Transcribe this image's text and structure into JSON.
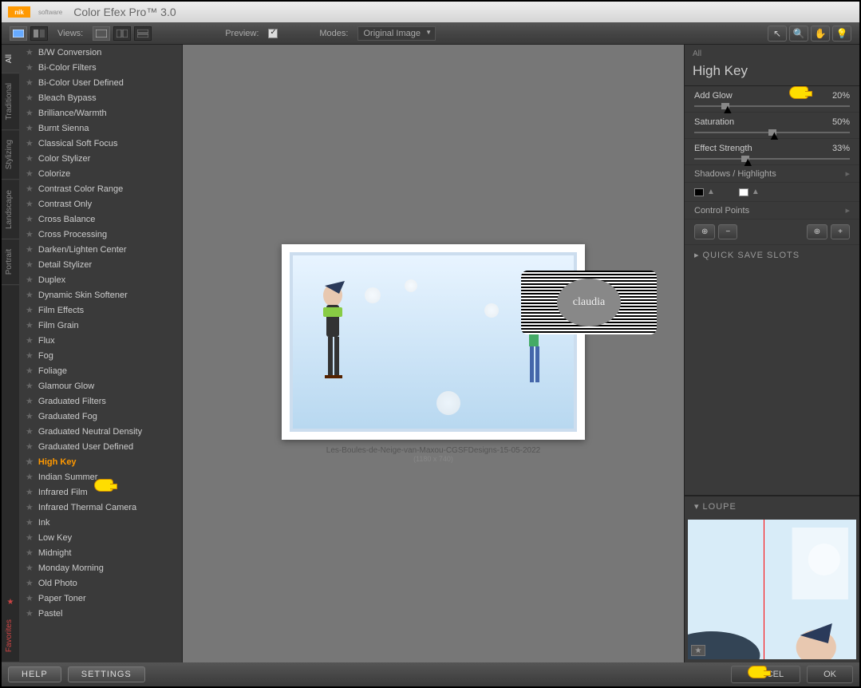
{
  "app": {
    "title": "Color Efex Pro™ 3.0",
    "brand": "nik",
    "brand_sub": "software"
  },
  "toolbar": {
    "views_label": "Views:",
    "preview_label": "Preview:",
    "modes_label": "Modes:",
    "mode_select": "Original Image"
  },
  "side_tabs": [
    "All",
    "Traditional",
    "Stylizing",
    "Landscape",
    "Portrait",
    "Favorites"
  ],
  "filters": [
    "B/W Conversion",
    "Bi-Color Filters",
    "Bi-Color User Defined",
    "Bleach Bypass",
    "Brilliance/Warmth",
    "Burnt Sienna",
    "Classical Soft Focus",
    "Color Stylizer",
    "Colorize",
    "Contrast Color Range",
    "Contrast Only",
    "Cross Balance",
    "Cross Processing",
    "Darken/Lighten Center",
    "Detail Stylizer",
    "Duplex",
    "Dynamic Skin Softener",
    "Film Effects",
    "Film Grain",
    "Flux",
    "Fog",
    "Foliage",
    "Glamour Glow",
    "Graduated Filters",
    "Graduated Fog",
    "Graduated Neutral Density",
    "Graduated User Defined",
    "High Key",
    "Indian Summer",
    "Infrared Film",
    "Infrared Thermal Camera",
    "Ink",
    "Low Key",
    "Midnight",
    "Monday Morning",
    "Old Photo",
    "Paper Toner",
    "Pastel"
  ],
  "selected_filter": "High Key",
  "preview": {
    "caption": "Les-Boules-de-Neige-van-Maxou-CGSFDesigns-15-05-2022",
    "dims": "(1180 x 740)"
  },
  "watermark": "claudia",
  "panel": {
    "category": "All",
    "title": "High Key",
    "sliders": [
      {
        "label": "Add Glow",
        "value": "20%",
        "pos": 20
      },
      {
        "label": "Saturation",
        "value": "50%",
        "pos": 50
      },
      {
        "label": "Effect Strength",
        "value": "33%",
        "pos": 33
      }
    ],
    "shadows_label": "Shadows / Highlights",
    "control_points_label": "Control Points",
    "quick_save": "QUICK SAVE SLOTS",
    "loupe": "LOUPE"
  },
  "bottom": {
    "help": "HELP",
    "settings": "SETTINGS",
    "cancel": "CANCEL",
    "ok": "OK"
  }
}
